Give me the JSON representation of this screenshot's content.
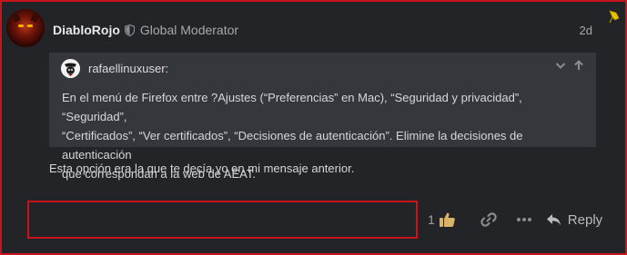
{
  "post": {
    "username": "DiabloRojo",
    "user_title": "Global Moderator",
    "date": "2d",
    "quote": {
      "username": "rafaellinuxuser:",
      "lines": [
        "En el menú de Firefox entre ?Ajustes (“Preferencias” en Mac), “Seguridad y privacidad”, “Seguridad”,",
        "“Certificados”, “Ver certificados”, “Decisiones de autenticación”. Elimine la decisiones de autenticación",
        "que correspondan a la web de AEAT."
      ]
    },
    "body": "Esta opción era la que te decía yo en mi mensaje anterior."
  },
  "actions": {
    "like_count": "1",
    "reply_label": "Reply"
  },
  "colors": {
    "highlight_border": "#c8141a",
    "like_icon": "#d9b36a",
    "pin_icon": "#e8c200"
  },
  "icons": [
    "shield-icon",
    "pin-icon",
    "chevron-down-icon",
    "arrow-up-icon",
    "like-icon",
    "link-icon",
    "more-icon",
    "reply-icon"
  ]
}
